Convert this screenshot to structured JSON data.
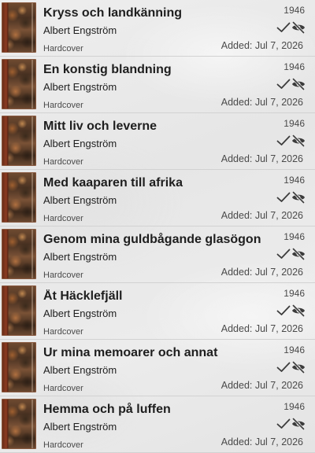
{
  "books": [
    {
      "title": "Kryss och landkänning",
      "author": "Albert Engström",
      "format": "Hardcover",
      "year": "1946",
      "added": "Added: Jul 7, 2026",
      "read_icon": "checkmark-icon",
      "hidden_icon": "eye-off-icon"
    },
    {
      "title": "En konstig blandning",
      "author": "Albert Engström",
      "format": "Hardcover",
      "year": "1946",
      "added": "Added: Jul 7, 2026",
      "read_icon": "checkmark-icon",
      "hidden_icon": "eye-off-icon"
    },
    {
      "title": "Mitt liv och leverne",
      "author": "Albert Engström",
      "format": "Hardcover",
      "year": "1946",
      "added": "Added: Jul 7, 2026",
      "read_icon": "checkmark-icon",
      "hidden_icon": "eye-off-icon"
    },
    {
      "title": "Med kaaparen till afrika",
      "author": "Albert Engström",
      "format": "Hardcover",
      "year": "1946",
      "added": "Added: Jul 7, 2026",
      "read_icon": "checkmark-icon",
      "hidden_icon": "eye-off-icon"
    },
    {
      "title": "Genom mina guldbågande glasögon",
      "author": "Albert Engström",
      "format": "Hardcover",
      "year": "1946",
      "added": "Added: Jul 7, 2026",
      "read_icon": "checkmark-icon",
      "hidden_icon": "eye-off-icon"
    },
    {
      "title": "Åt Häcklefjäll",
      "author": "Albert Engström",
      "format": "Hardcover",
      "year": "1946",
      "added": "Added: Jul 7, 2026",
      "read_icon": "checkmark-icon",
      "hidden_icon": "eye-off-icon"
    },
    {
      "title": "Ur mina memoarer och annat",
      "author": "Albert Engström",
      "format": "Hardcover",
      "year": "1946",
      "added": "Added: Jul 7, 2026",
      "read_icon": "checkmark-icon",
      "hidden_icon": "eye-off-icon"
    },
    {
      "title": "Hemma och på luffen",
      "author": "Albert Engström",
      "format": "Hardcover",
      "year": "1946",
      "added": "Added: Jul 7, 2026",
      "read_icon": "checkmark-icon",
      "hidden_icon": "eye-off-icon"
    }
  ],
  "colors": {
    "text_primary": "#1e1e1e",
    "text_secondary": "#4a4a4a",
    "icon": "#3c3c3c",
    "divider": "#d2d2d2"
  }
}
